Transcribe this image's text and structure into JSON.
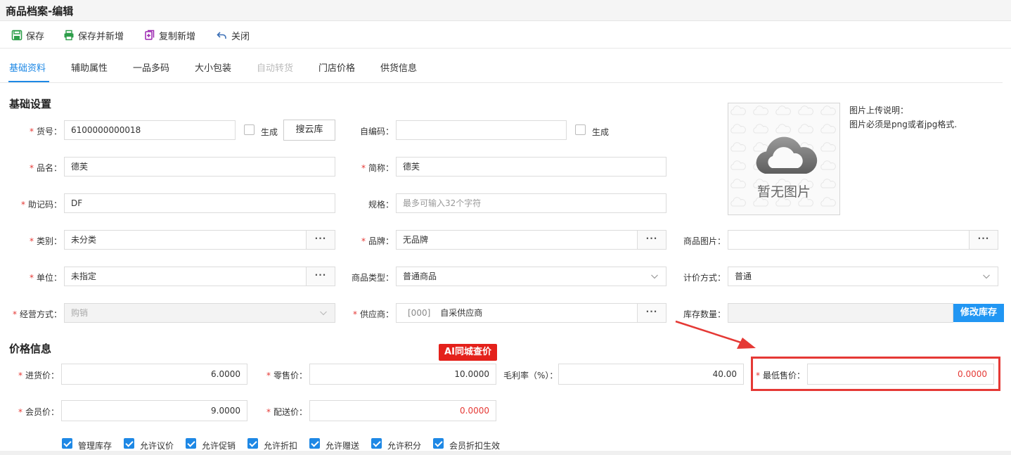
{
  "window": {
    "title": "商品档案-编辑"
  },
  "toolbar": {
    "save": "保存",
    "save_new": "保存并新增",
    "copy_new": "复制新增",
    "close": "关闭"
  },
  "tabs": [
    {
      "label": "基础资料",
      "active": true
    },
    {
      "label": "辅助属性"
    },
    {
      "label": "一品多码"
    },
    {
      "label": "大小包装"
    },
    {
      "label": "自动转货",
      "disabled": true
    },
    {
      "label": "门店价格"
    },
    {
      "label": "供货信息"
    }
  ],
  "basic": {
    "title": "基础设置",
    "sku_label": "货号：",
    "sku_value": "6100000000018",
    "sku_gen_label": "生成",
    "search_cloud": "搜云库",
    "selfcode_label": "自编码：",
    "selfcode_value": "",
    "selfcode_gen_label": "生成",
    "name_label": "品名：",
    "name_value": "德芙",
    "short_label": "简称：",
    "short_value": "德芙",
    "mnemonic_label": "助记码：",
    "mnemonic_value": "DF",
    "spec_label": "规格：",
    "spec_placeholder": "最多可输入32个字符",
    "category_label": "类别：",
    "category_value": "未分类",
    "more": "···",
    "brand_label": "品牌：",
    "brand_value": "无品牌",
    "image_label": "商品图片：",
    "image_value": "",
    "unit_label": "单位：",
    "unit_value": "未指定",
    "goods_type_label": "商品类型：",
    "goods_type_value": "普通商品",
    "pricing_label": "计价方式：",
    "pricing_value": "普通",
    "biz_label": "经营方式：",
    "biz_value": "购销",
    "supplier_label": "供应商：",
    "supplier_code": "[000]",
    "supplier_value": "自采供应商",
    "stock_label": "库存数量：",
    "stock_value": "",
    "modify_stock": "修改库存",
    "no_image": "暂无图片",
    "img_note_title": "图片上传说明：",
    "img_note_text": "图片必须是png或者jpg格式."
  },
  "price": {
    "title": "价格信息",
    "ai_badge": "AI同城查价",
    "purchase_label": "进货价：",
    "purchase_value": "6.0000",
    "retail_label": "零售价：",
    "retail_value": "10.0000",
    "margin_label": "毛利率（%）：",
    "margin_value": "40.00",
    "min_label": "最低售价：",
    "min_value": "0.0000",
    "member_label": "会员价：",
    "member_value": "9.0000",
    "delivery_label": "配送价：",
    "delivery_value": "0.0000"
  },
  "options": [
    {
      "label": "管理库存",
      "checked": true
    },
    {
      "label": "允许议价",
      "checked": true
    },
    {
      "label": "允许促销",
      "checked": true
    },
    {
      "label": "允许折扣",
      "checked": true
    },
    {
      "label": "允许赠送",
      "checked": true
    },
    {
      "label": "允许积分",
      "checked": true
    },
    {
      "label": "会员折扣生效",
      "checked": true
    }
  ],
  "colors": {
    "accent": "#1e88e5",
    "required": "#e53935",
    "ai_badge": "#e4211b",
    "highlight": "#e53935"
  }
}
